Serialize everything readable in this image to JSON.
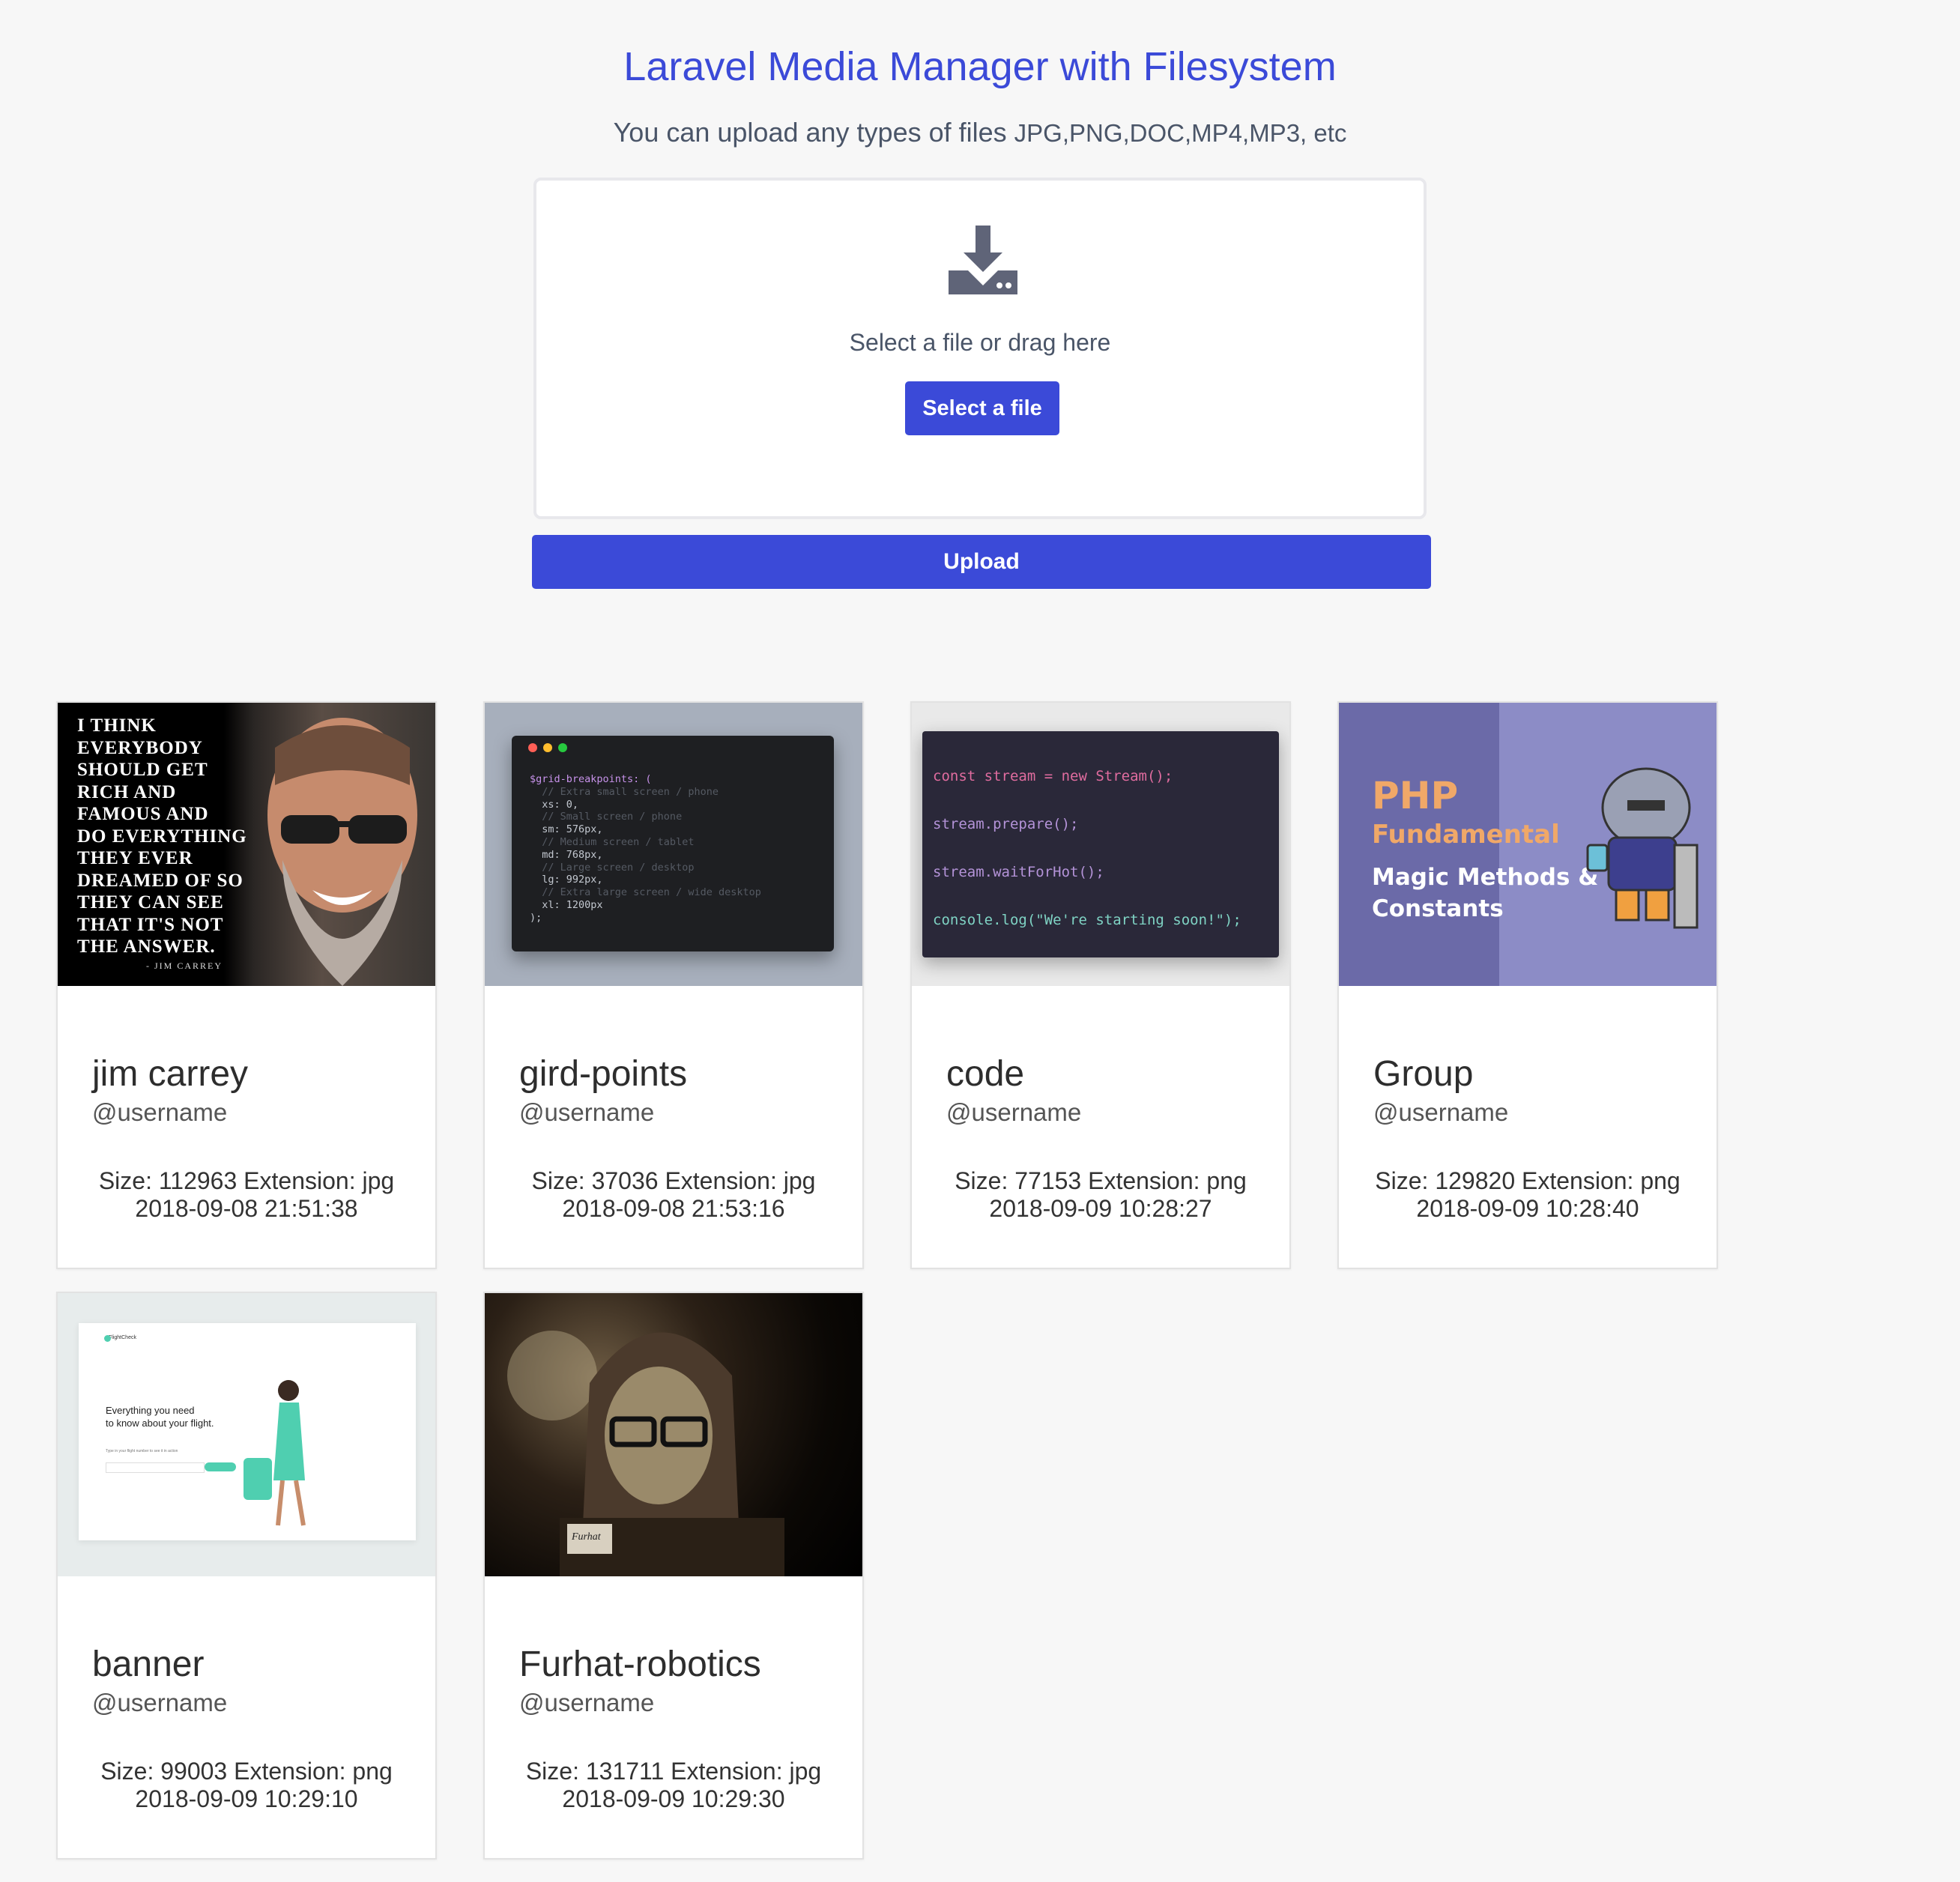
{
  "header": {
    "title": "Laravel Media Manager with Filesystem",
    "subtitle_prefix": "You can upload any types of files ",
    "subtitle_types": "JPG,PNG,DOC,MP4,MP3, etc"
  },
  "dropzone": {
    "icon": "download-tray-icon",
    "text": "Select a file or drag here",
    "button_label": "Select a file"
  },
  "upload_button_label": "Upload",
  "colors": {
    "accent": "#3b4ad8",
    "background": "#f7f7f7"
  },
  "media": [
    {
      "name": "jim carrey",
      "user": "@username",
      "size_label": "Size:",
      "size": "112963",
      "ext_label": "Extension:",
      "ext": "jpg",
      "date": "2018-09-08 21:51:38"
    },
    {
      "name": "gird-points",
      "user": "@username",
      "size_label": "Size:",
      "size": "37036",
      "ext_label": "Extension:",
      "ext": "jpg",
      "date": "2018-09-08 21:53:16"
    },
    {
      "name": "code",
      "user": "@username",
      "size_label": "Size:",
      "size": "77153",
      "ext_label": "Extension:",
      "ext": "png",
      "date": "2018-09-09 10:28:27"
    },
    {
      "name": "Group",
      "user": "@username",
      "size_label": "Size:",
      "size": "129820",
      "ext_label": "Extension:",
      "ext": "png",
      "date": "2018-09-09 10:28:40"
    },
    {
      "name": "banner",
      "user": "@username",
      "size_label": "Size:",
      "size": "99003",
      "ext_label": "Extension:",
      "ext": "png",
      "date": "2018-09-09 10:29:10"
    },
    {
      "name": "Furhat-robotics",
      "user": "@username",
      "size_label": "Size:",
      "size": "131711",
      "ext_label": "Extension:",
      "ext": "jpg",
      "date": "2018-09-09 10:29:30"
    }
  ],
  "thumbs": {
    "jim_quote": [
      "I THINK",
      "EVERYBODY",
      "SHOULD GET",
      "RICH AND",
      "FAMOUS AND",
      "DO EVERYTHING",
      "THEY EVER",
      "DREAMED OF SO",
      "THEY CAN SEE",
      "THAT IT'S NOT",
      "THE ANSWER."
    ],
    "jim_by": "- JIM CARREY",
    "grid_code": [
      "$grid-breakpoints: (",
      "  // Extra small screen / phone",
      "  xs: 0,",
      "  // Small screen / phone",
      "  sm: 576px,",
      "  // Medium screen / tablet",
      "  md: 768px,",
      "  // Large screen / desktop",
      "  lg: 992px,",
      "  // Extra large screen / wide desktop",
      "  xl: 1200px",
      ");"
    ],
    "code_lines": [
      "const stream = new Stream();",
      "stream.prepare();",
      "stream.waitForHot();",
      "console.log(\"We're starting soon!\");"
    ],
    "php_title": "PHP",
    "php_sub": "Fundamental",
    "php_line1": "Magic Methods &",
    "php_line2": "Constants",
    "banner_brand": "FlightCheck",
    "banner_headline1": "Everything you need",
    "banner_headline2": "to know about your flight.",
    "banner_hint": "Type in your flight number to see it in action",
    "furhat_label": "Furhat"
  }
}
